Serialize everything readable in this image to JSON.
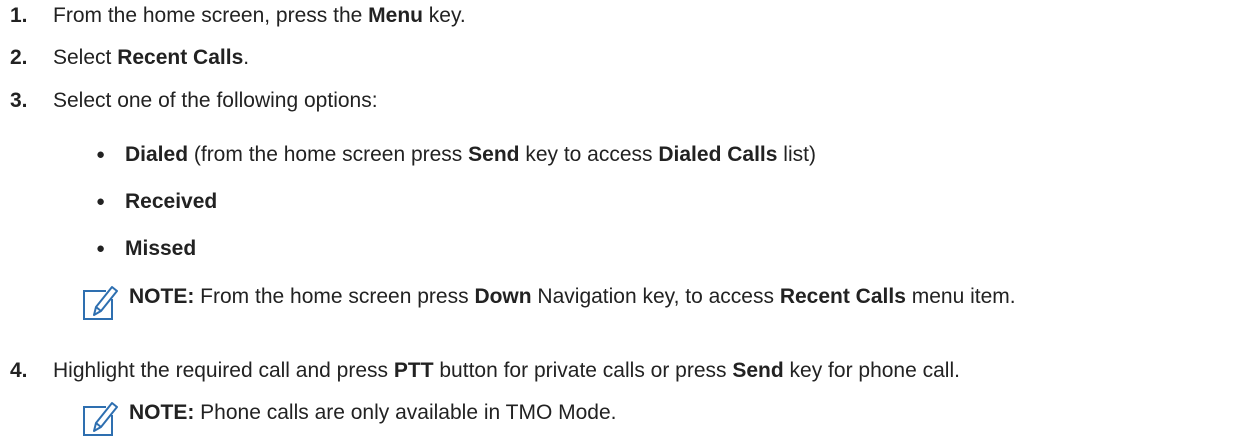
{
  "steps": [
    {
      "num": "1.",
      "pre": "From the home screen, press the ",
      "b1": "Menu",
      "post": " key."
    },
    {
      "num": "2.",
      "pre": "Select ",
      "b1": "Recent Calls",
      "post": "."
    },
    {
      "num": "3.",
      "text": "Select one of the following options:"
    },
    {
      "num": "4.",
      "pre": "Highlight the required call and press ",
      "b1": "PTT",
      "mid": " button for private calls or press ",
      "b2": "Send",
      "post": " key for phone call."
    }
  ],
  "options": [
    {
      "bullet": "●",
      "b1": "Dialed",
      "pre": " (from the home screen press ",
      "b2": "Send",
      "mid": " key to access ",
      "b3": "Dialed Calls",
      "post": " list)"
    },
    {
      "bullet": "●",
      "b1": "Received"
    },
    {
      "bullet": "●",
      "b1": "Missed"
    }
  ],
  "notes": [
    {
      "label": "NOTE:",
      "pre": " From the home screen press ",
      "b1": "Down",
      "mid": " Navigation key, to access ",
      "b2": "Recent Calls",
      "post": " menu item.",
      "icon": "note-pencil-icon",
      "icon_color": "#2e6fb0"
    },
    {
      "label": "NOTE:",
      "text": " Phone calls are only available in TMO Mode.",
      "icon": "note-pencil-icon",
      "icon_color": "#2e6fb0"
    }
  ]
}
